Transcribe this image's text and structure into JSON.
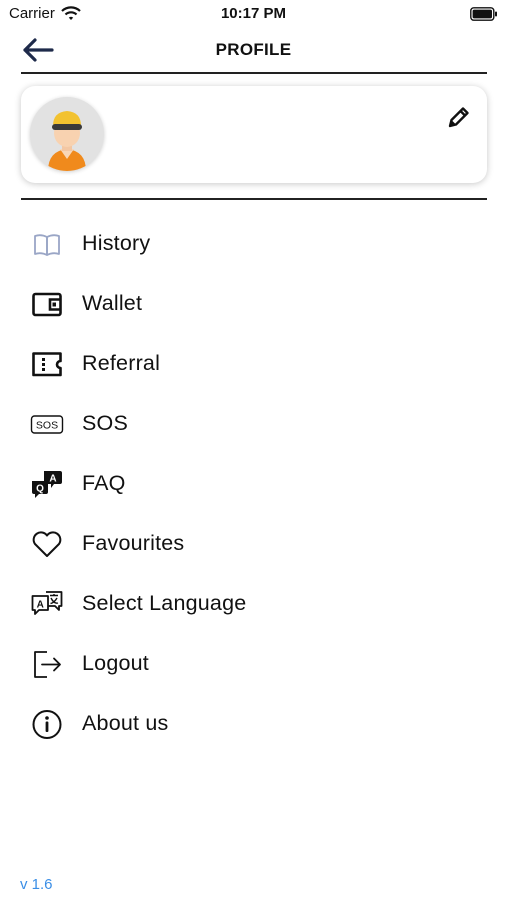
{
  "status_bar": {
    "carrier": "Carrier",
    "time": "10:17 PM"
  },
  "header": {
    "title": "PROFILE"
  },
  "menu": {
    "items": [
      {
        "label": "History",
        "icon": "book-icon"
      },
      {
        "label": "Wallet",
        "icon": "wallet-icon"
      },
      {
        "label": "Referral",
        "icon": "ticket-icon"
      },
      {
        "label": "SOS",
        "icon": "sos-icon",
        "icon_text": "SOS"
      },
      {
        "label": "FAQ",
        "icon": "faq-icon",
        "icon_text_q": "Q",
        "icon_text_a": "A"
      },
      {
        "label": "Favourites",
        "icon": "heart-icon"
      },
      {
        "label": "Select Language",
        "icon": "language-icon",
        "icon_text": "A"
      },
      {
        "label": "Logout",
        "icon": "logout-icon"
      },
      {
        "label": "About us",
        "icon": "info-icon"
      }
    ]
  },
  "footer": {
    "version": "v 1.6"
  },
  "colors": {
    "accent": "#3a8ee6",
    "history_icon": "#9aa6c6",
    "avatar_hat": "#f2c230",
    "avatar_shirt": "#f08a1c"
  }
}
